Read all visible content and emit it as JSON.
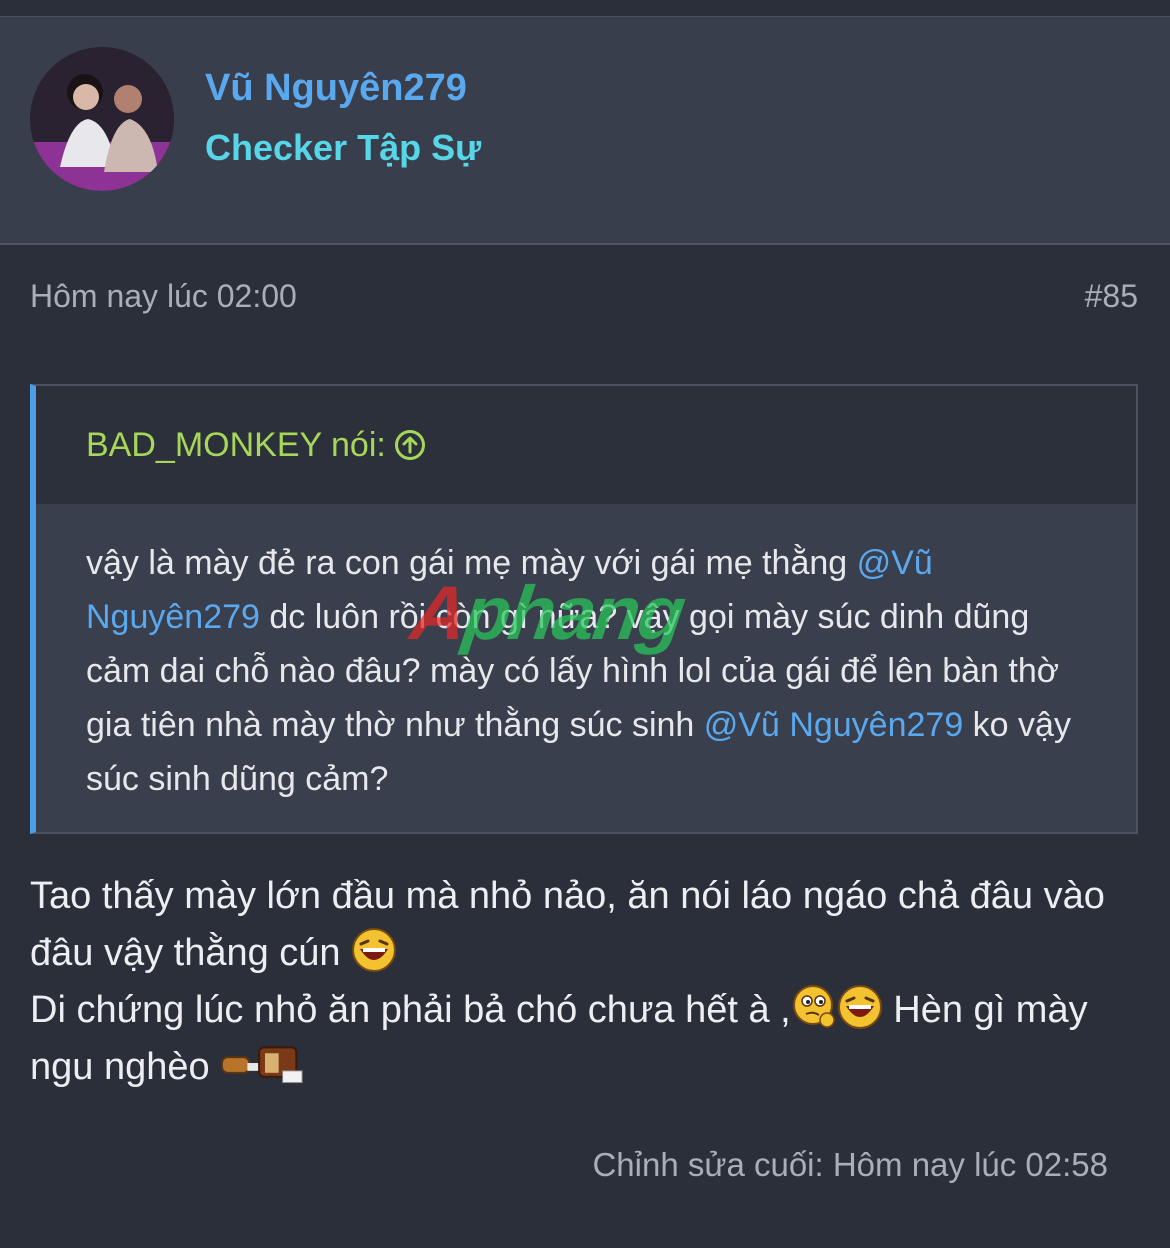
{
  "user": {
    "name": "Vũ Nguyên279",
    "title": "Checker Tập Sự"
  },
  "post": {
    "date": "Hôm nay lúc 02:00",
    "number": "#85",
    "quote": {
      "author_label": "BAD_MONKEY nói:",
      "part1": "vậy là mày đẻ ra con gái mẹ mày với gái mẹ thằng ",
      "mention1": "@Vũ Nguyên279",
      "part2": " dc luôn rồi còn gì nữa? vậy gọi mày súc dinh dũng cảm dai chỗ nào đâu? mày có lấy hình lol của gái để lên bàn thờ gia tiên nhà mày thờ như thằng súc sinh ",
      "mention2": "@Vũ Nguyên279",
      "part3": " ko vậy súc sinh dũng cảm?"
    },
    "reply": {
      "line1": "Tao thấy mày lớn đầu mà nhỏ nảo, ăn nói láo ngáo chả đâu vào đâu vậy thằng cún ",
      "line2": "Di chứng lúc nhỏ ăn phải bả chó chưa hết à ,",
      "line2b": " Hèn gì mày ngu nghèo "
    },
    "edited": "Chỉnh sửa cuối: Hôm nay lúc 02:58"
  },
  "watermark": {
    "first": "A",
    "rest": "phang"
  },
  "colors": {
    "background": "#2b2f3a",
    "header_bg": "#393e4c",
    "link": "#5aa8ee",
    "user_title": "#57d6e8",
    "quote_author": "#a6d65a",
    "quote_border": "#4f9fe8"
  }
}
